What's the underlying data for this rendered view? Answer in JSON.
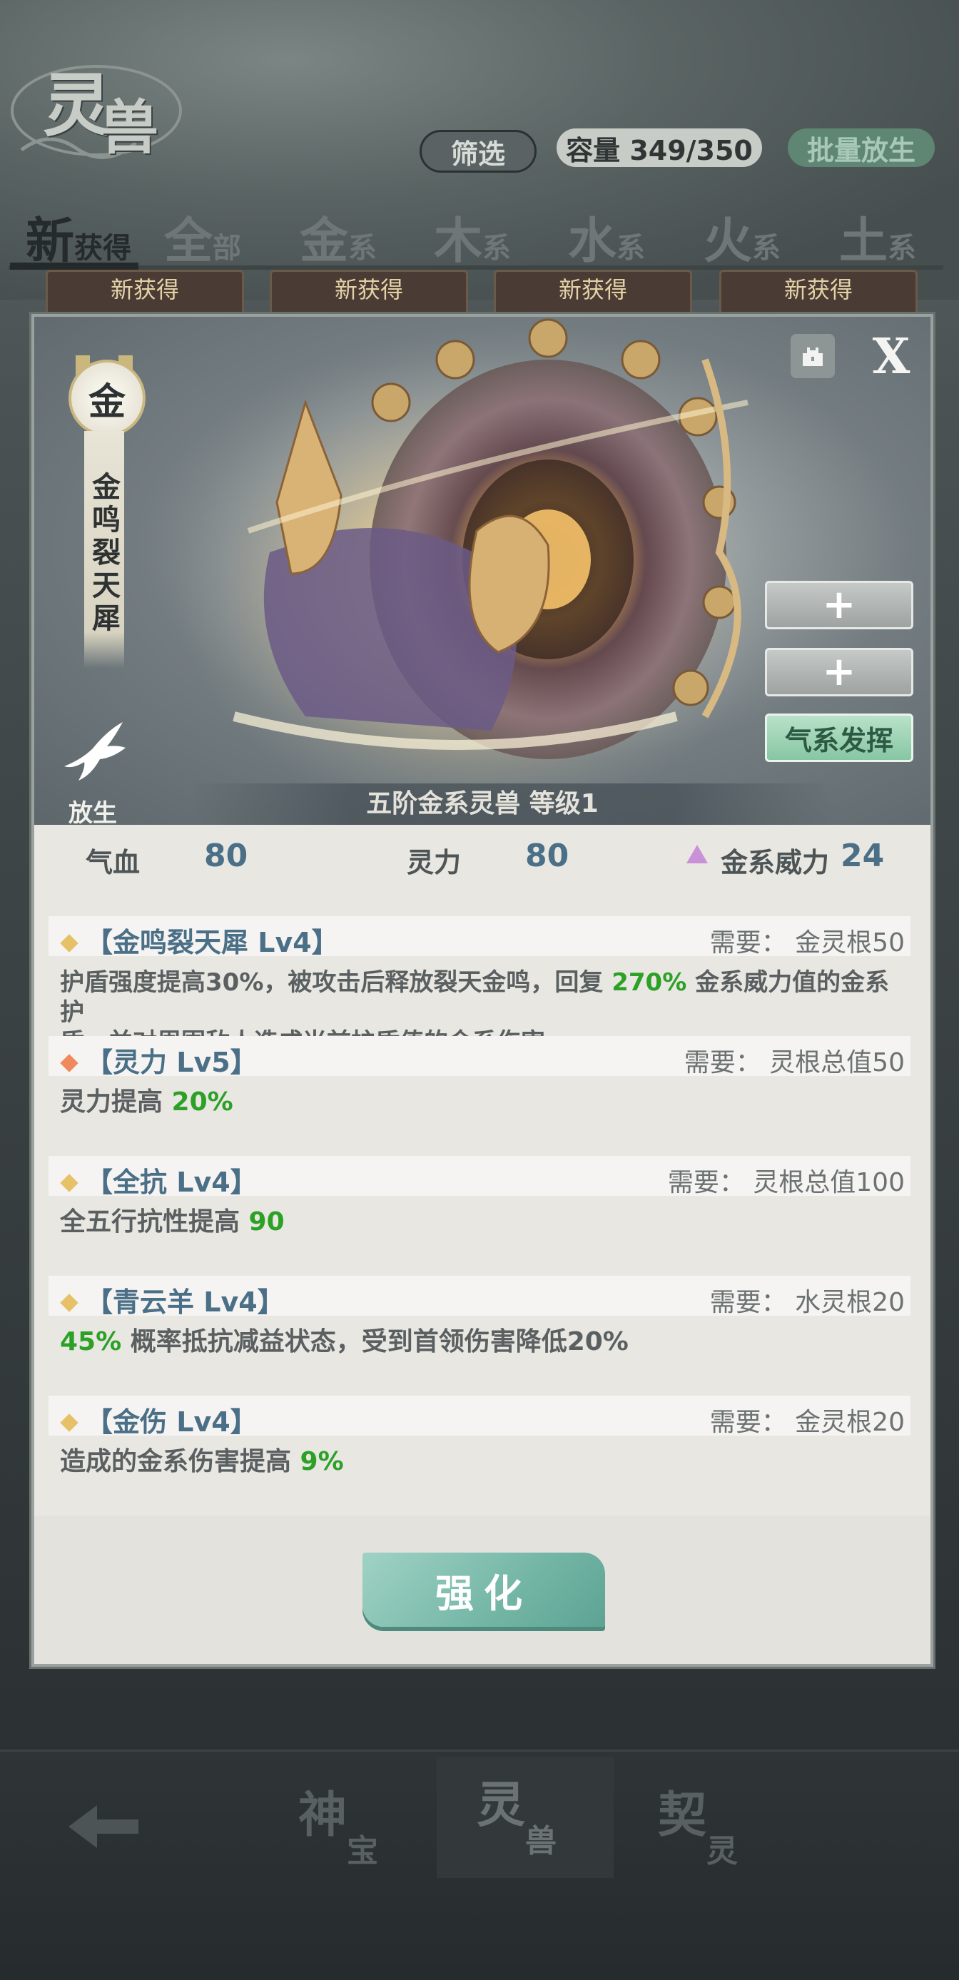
{
  "header": {
    "title_char1": "灵",
    "title_char2": "兽",
    "filter_label": "筛选",
    "capacity_label": "容量 349/350",
    "batch_release_label": "批量放生"
  },
  "tabs": [
    {
      "big": "新",
      "small": "获得"
    },
    {
      "big": "全",
      "small": "部"
    },
    {
      "big": "金",
      "small": "系"
    },
    {
      "big": "木",
      "small": "系"
    },
    {
      "big": "水",
      "small": "系"
    },
    {
      "big": "火",
      "small": "系"
    },
    {
      "big": "土",
      "small": "系"
    }
  ],
  "new_tags": [
    "新获得",
    "新获得",
    "新获得",
    "新获得"
  ],
  "modal": {
    "element_char": "金",
    "beast_name": "金鸣裂天犀",
    "release_label": "放生",
    "qi_button_label": "气系发挥",
    "plus_symbol": "+",
    "close_symbol": "X",
    "caption": "五阶金系灵兽 等级1",
    "stats": {
      "hp_label": "气血",
      "hp_value": "80",
      "spirit_label": "灵力",
      "spirit_value": "80",
      "power_label": "金系威力",
      "power_value": "24"
    },
    "skills": [
      {
        "name": "【金鸣裂天犀 Lv4】",
        "requirement": "需要： 金灵根50",
        "desc_part1": "护盾强度提高30%，被攻击后释放裂天金鸣，回复 ",
        "desc_highlight": "270%",
        "desc_part2": " 金系威力值的金系护",
        "desc_line2": "盾，并对周围敌人造成当前护盾值的金系伤害"
      },
      {
        "name": "【灵力 Lv5】",
        "requirement": "需要： 灵根总值50",
        "desc_part1": "灵力提高 ",
        "desc_highlight": "20%"
      },
      {
        "name": "【全抗 Lv4】",
        "requirement": "需要： 灵根总值100",
        "desc_part1": "全五行抗性提高 ",
        "desc_highlight": "90"
      },
      {
        "name": "【青云羊 Lv4】",
        "requirement": "需要： 水灵根20",
        "desc_highlight": "45%",
        "desc_part2": " 概率抵抗减益状态，受到首领伤害降低20%"
      },
      {
        "name": "【金伤 Lv4】",
        "requirement": "需要： 金灵根20",
        "desc_part1": "造成的金系伤害提高 ",
        "desc_highlight": "9%"
      }
    ],
    "enhance_label": "强化"
  },
  "bottom_nav": [
    {
      "big": "神",
      "small": "宝"
    },
    {
      "big": "灵",
      "small": "兽"
    },
    {
      "big": "契",
      "small": "灵"
    }
  ],
  "colors": {
    "accent_green": "#2ca126",
    "stat_blue": "#4a6f87",
    "gold_diamond": "#e6c168",
    "orange_diamond": "#f08a5d",
    "triangle_purple": "#c992d8"
  }
}
